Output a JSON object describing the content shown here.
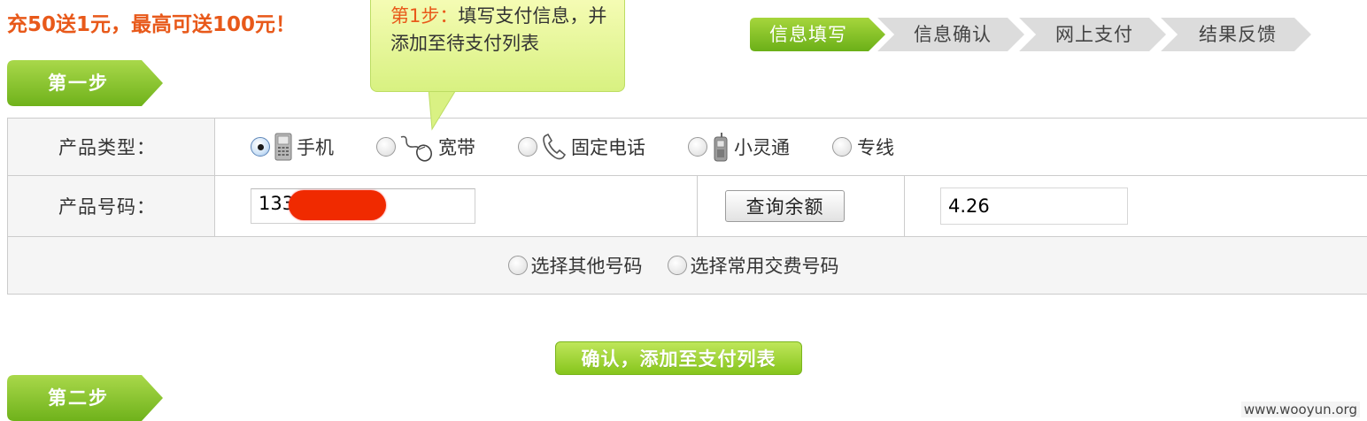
{
  "promo": {
    "text": "充50送1元，最高可送100元！"
  },
  "tooltip": {
    "step_label": "第1步：",
    "text": "填写支付信息，并添加至待支付列表"
  },
  "progress": {
    "steps": [
      {
        "label": "信息填写",
        "active": true
      },
      {
        "label": "信息确认",
        "active": false
      },
      {
        "label": "网上支付",
        "active": false
      },
      {
        "label": "结果反馈",
        "active": false
      }
    ],
    "active_color": "#7cbd1e",
    "inactive_color": "#d9d9d9"
  },
  "step1": {
    "title": "第一步"
  },
  "step2": {
    "title": "第二步"
  },
  "form": {
    "product_type_label": "产品类型：",
    "product_types": [
      {
        "label": "手机",
        "icon": "mobile-phone-icon",
        "checked": true
      },
      {
        "label": "宽带",
        "icon": "mouse-icon",
        "checked": false
      },
      {
        "label": "固定电话",
        "icon": "telephone-icon",
        "checked": false
      },
      {
        "label": "小灵通",
        "icon": "cellphone-icon",
        "checked": false
      },
      {
        "label": "专线",
        "icon": "",
        "checked": false
      }
    ],
    "product_number_label": "产品号码：",
    "product_number_value": "133",
    "query_button": "查询余额",
    "balance_value": "4.26",
    "other_options": [
      {
        "label": "选择其他号码",
        "checked": false
      },
      {
        "label": "选择常用交费号码",
        "checked": false
      }
    ]
  },
  "confirm_button": "确认，添加至支付列表",
  "watermark": "www.wooyun.org"
}
